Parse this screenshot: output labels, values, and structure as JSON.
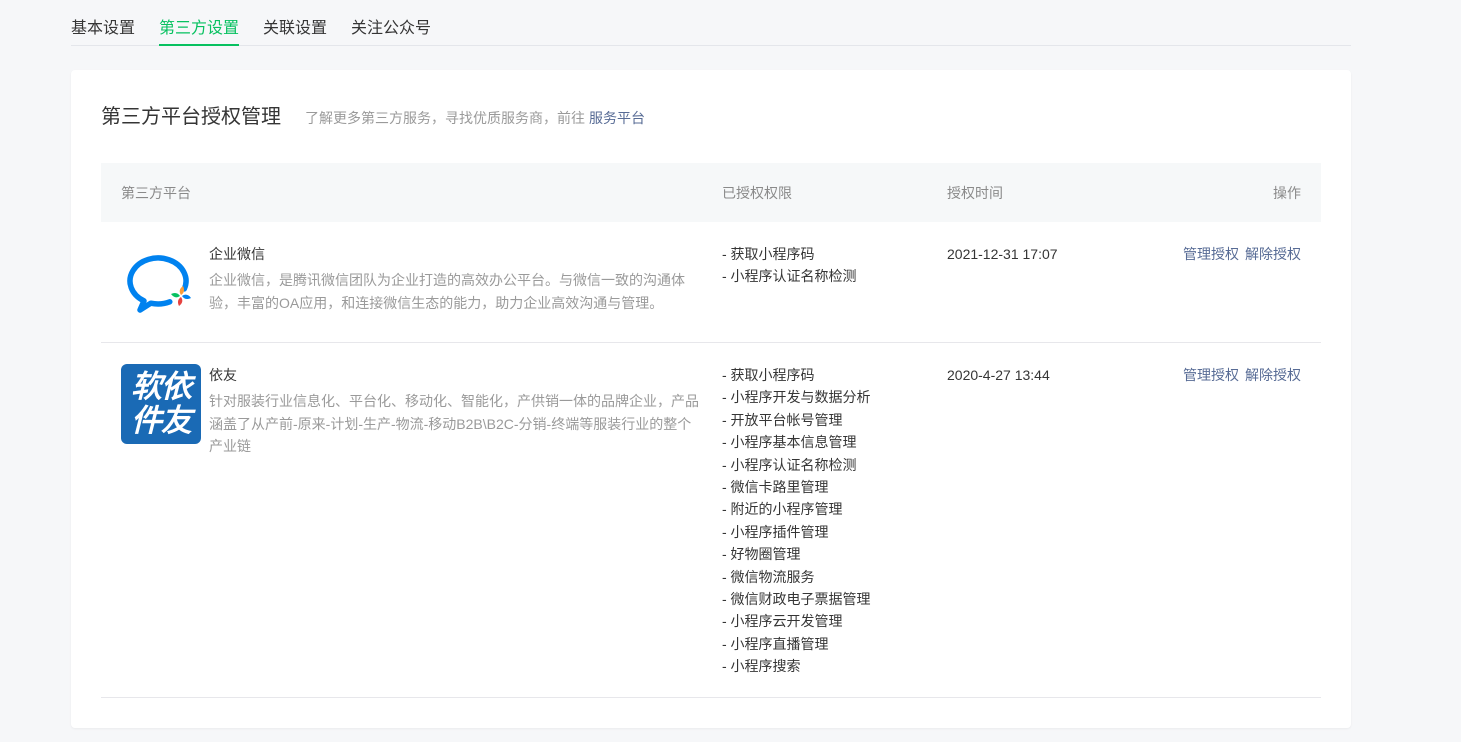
{
  "tabs": [
    {
      "label": "基本设置",
      "active": false
    },
    {
      "label": "第三方设置",
      "active": true
    },
    {
      "label": "关联设置",
      "active": false
    },
    {
      "label": "关注公众号",
      "active": false
    }
  ],
  "section": {
    "title": "第三方平台授权管理",
    "subtitle": "了解更多第三方服务，寻找优质服务商，前往",
    "link_label": "服务平台"
  },
  "table": {
    "columns": [
      "第三方平台",
      "已授权权限",
      "授权时间",
      "操作"
    ],
    "rows": [
      {
        "icon": "wecom-logo-icon",
        "name": "企业微信",
        "description": "企业微信，是腾讯微信团队为企业打造的高效办公平台。与微信一致的沟通体验，丰富的OA应用，和连接微信生态的能力，助力企业高效沟通与管理。",
        "permissions": [
          "- 获取小程序码",
          "- 小程序认证名称检测"
        ],
        "authorized_time": "2021-12-31 17:07",
        "actions": [
          "管理授权",
          "解除授权"
        ]
      },
      {
        "icon": "yiyou-logo-icon",
        "logo_text": [
          "软依",
          "件友"
        ],
        "name": "依友",
        "description": "针对服装行业信息化、平台化、移动化、智能化，产供销一体的品牌企业，产品涵盖了从产前-原来-计划-生产-物流-移动B2B\\B2C-分销-终端等服装行业的整个产业链",
        "permissions": [
          "- 获取小程序码",
          "- 小程序开发与数据分析",
          "- 开放平台帐号管理",
          "- 小程序基本信息管理",
          "- 小程序认证名称检测",
          "- 微信卡路里管理",
          "- 附近的小程序管理",
          "- 小程序插件管理",
          "- 好物圈管理",
          "- 微信物流服务",
          "- 微信财政电子票据管理",
          "- 小程序云开发管理",
          "- 小程序直播管理",
          "- 小程序搜索"
        ],
        "authorized_time": "2020-4-27 13:44",
        "actions": [
          "管理授权",
          "解除授权"
        ]
      }
    ]
  },
  "colors": {
    "accent": "#07c160",
    "link": "#576b95",
    "page_bg": "#f6f7f9",
    "wecom": "#0082ef",
    "yiyou": "#1a6ab5"
  }
}
